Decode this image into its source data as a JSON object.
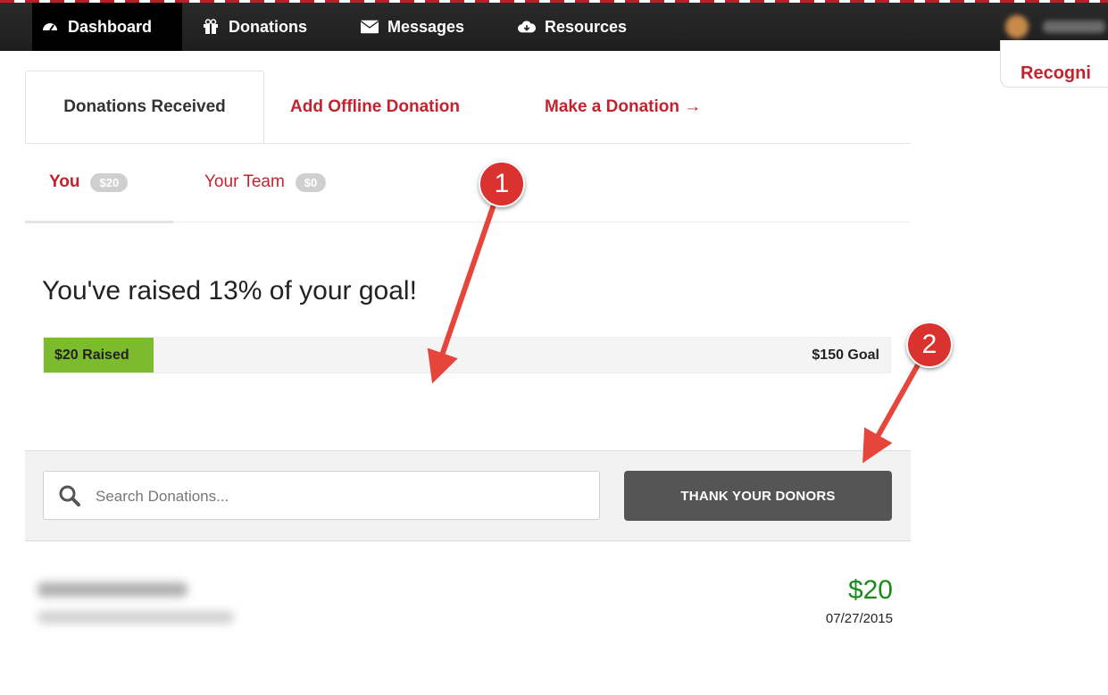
{
  "nav": {
    "items": [
      {
        "label": "Dashboard",
        "icon": "dashboard-icon",
        "active": true
      },
      {
        "label": "Donations",
        "icon": "gift-icon",
        "active": false
      },
      {
        "label": "Messages",
        "icon": "envelope-icon",
        "active": false
      },
      {
        "label": "Resources",
        "icon": "cloud-download-icon",
        "active": false
      }
    ]
  },
  "side_card": {
    "label": "Recogni"
  },
  "tabs": {
    "received": "Donations Received",
    "offline": "Add Offline Donation",
    "make": "Make a Donation →"
  },
  "subtabs": {
    "you": {
      "label": "You",
      "badge": "$20"
    },
    "team": {
      "label": "Your Team",
      "badge": "$0"
    }
  },
  "goal": {
    "headline": "You've raised 13% of your goal!",
    "raised_label": "$20 Raised",
    "goal_label": "$150 Goal",
    "percent": 13
  },
  "search": {
    "placeholder": "Search Donations..."
  },
  "thank_button": "THANK YOUR DONORS",
  "donations": [
    {
      "amount": "$20",
      "date": "07/27/2015"
    }
  ],
  "annotations": {
    "marker1": "1",
    "marker2": "2"
  },
  "colors": {
    "brand_red": "#c1232f",
    "progress_green": "#7dbb2e",
    "amount_green": "#1a8a1a",
    "annotation_red": "#d9322f"
  }
}
